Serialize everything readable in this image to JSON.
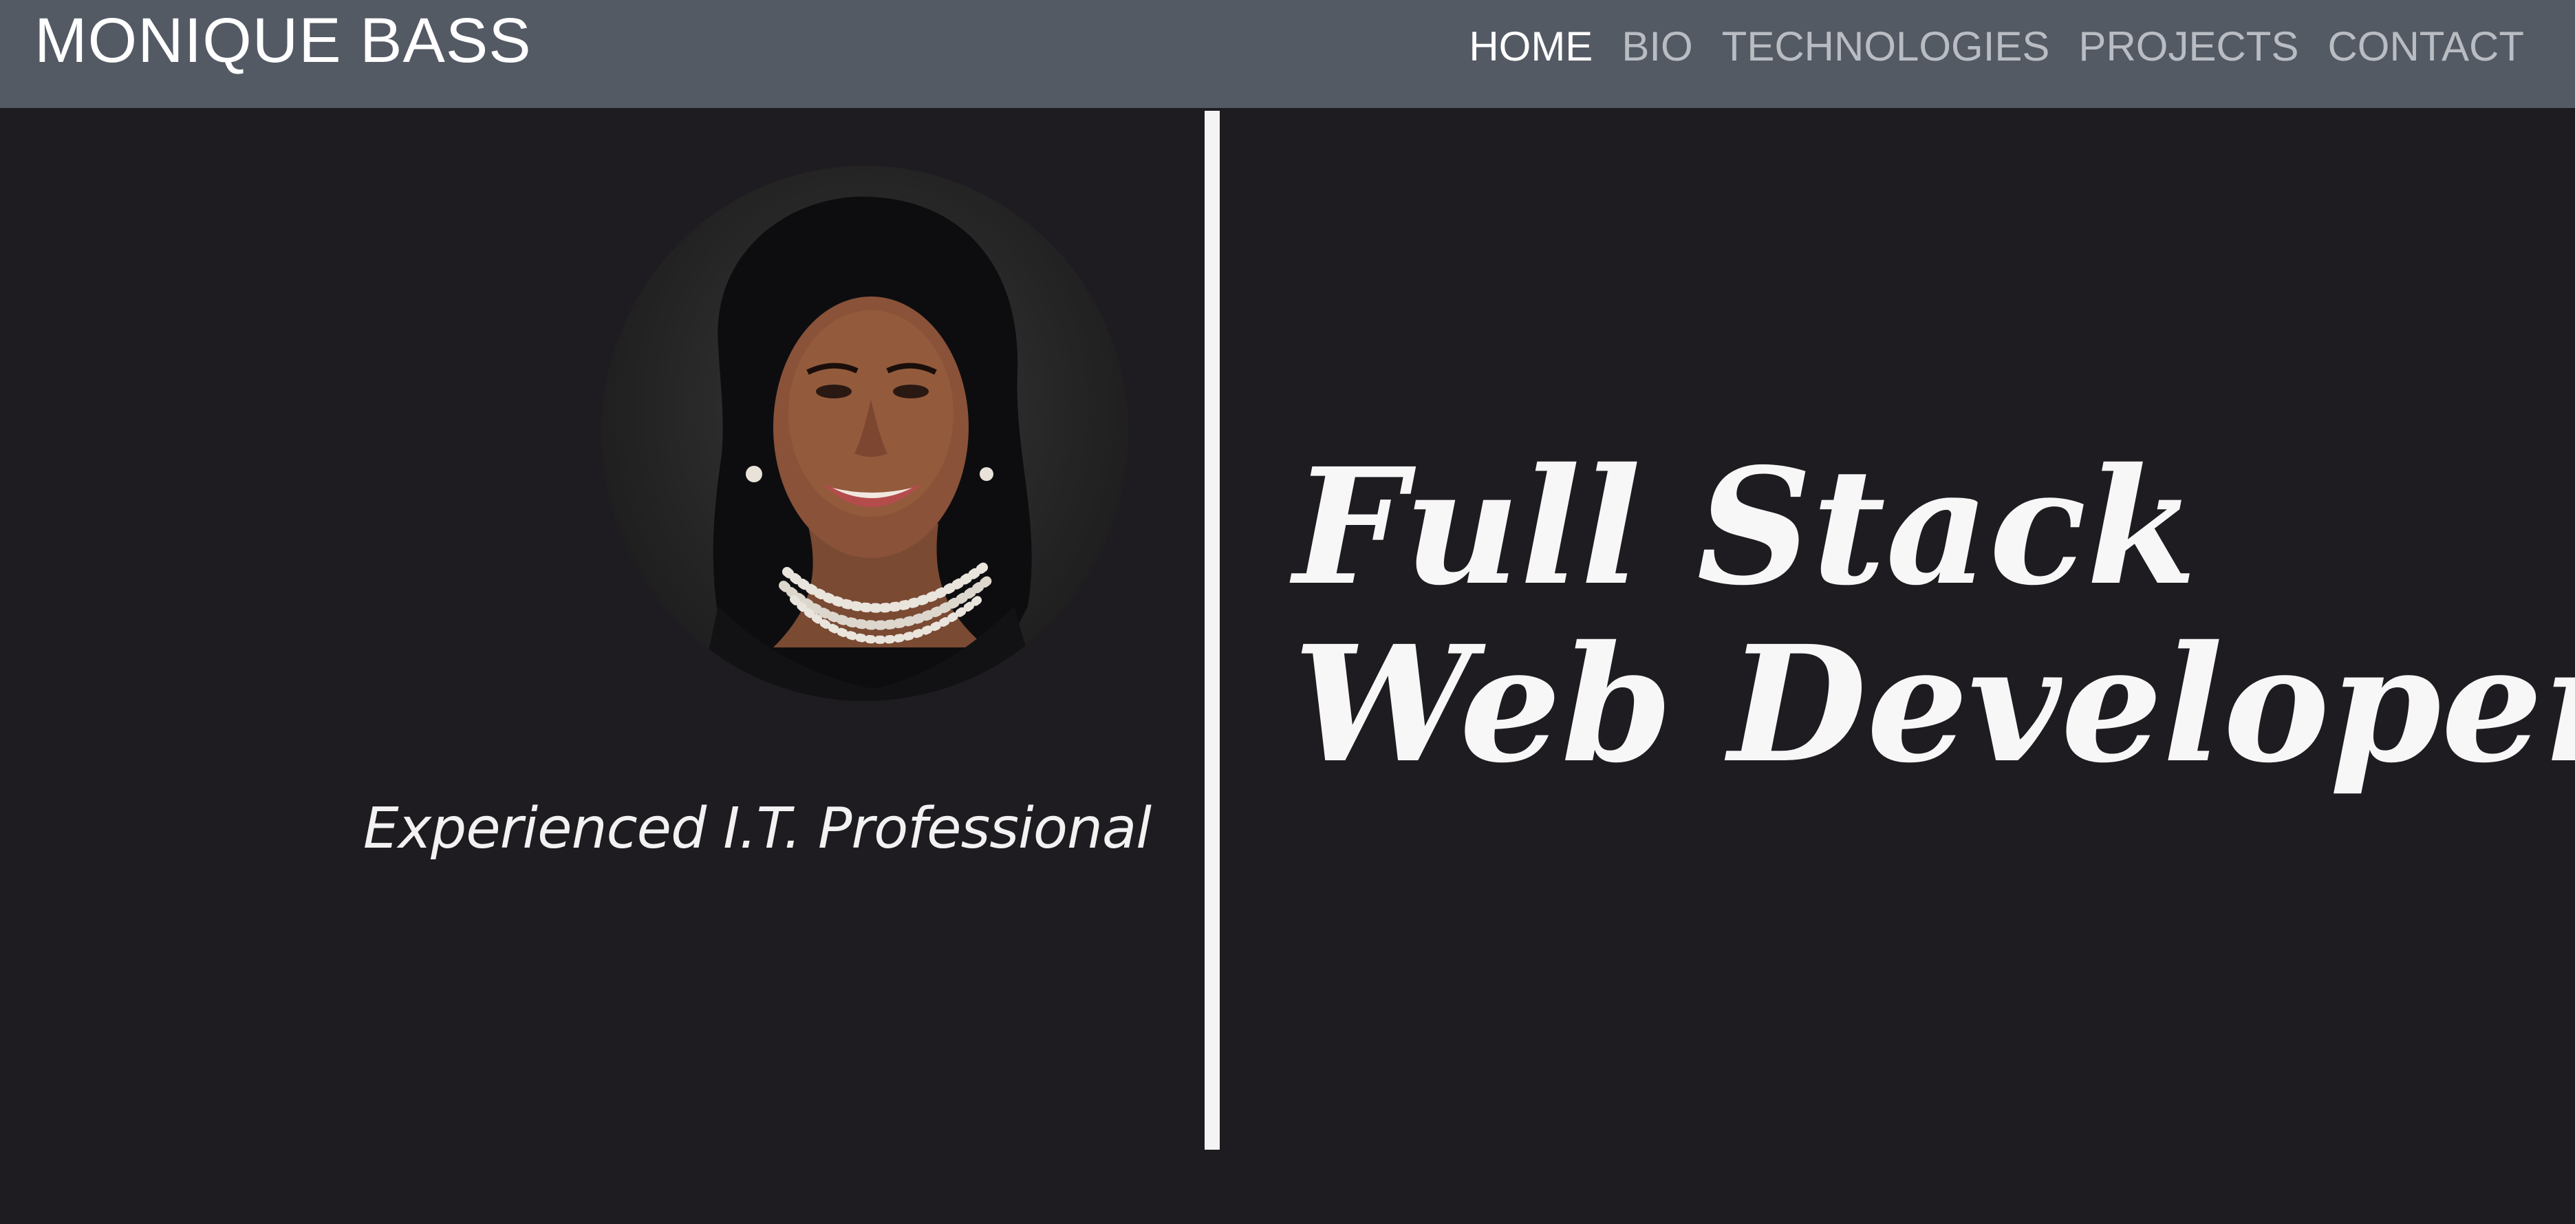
{
  "header": {
    "brand": "MONIQUE BASS",
    "nav": [
      {
        "label": "HOME",
        "active": true
      },
      {
        "label": "BIO",
        "active": false
      },
      {
        "label": "TECHNOLOGIES",
        "active": false
      },
      {
        "label": "PROJECTS",
        "active": false
      },
      {
        "label": "CONTACT",
        "active": false
      }
    ]
  },
  "hero": {
    "tagline": "Experienced I.T. Professional",
    "headline_line1": "Full Stack",
    "headline_line2": "Web Developer"
  },
  "colors": {
    "navbar_bg": "#545a64",
    "page_bg": "#1e1c20",
    "nav_active": "#ffffff",
    "nav_inactive": "#b9bdc3",
    "divider": "#f4f4f4"
  }
}
